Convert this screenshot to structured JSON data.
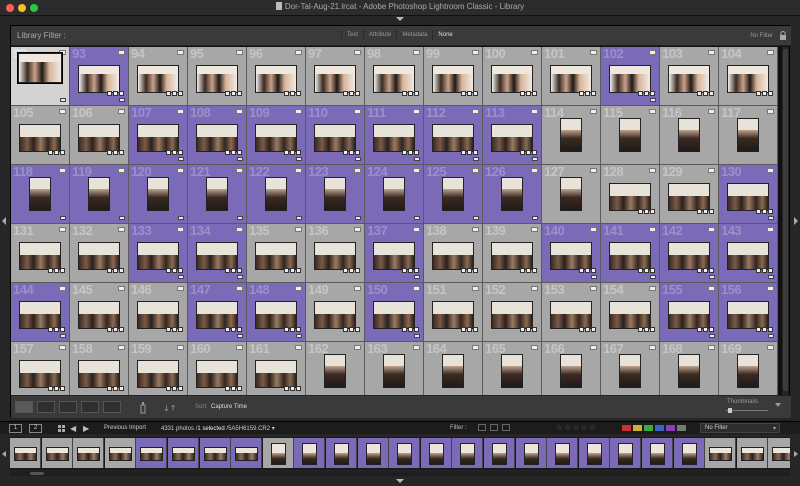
{
  "window": {
    "title": "Dor-Tal-Aug-21.lrcat - Adobe Photoshop Lightroom Classic - Library",
    "traffic_lights": [
      "#ff5f57",
      "#febc2e",
      "#28c840"
    ]
  },
  "filter_bar": {
    "label": "Library Filter :",
    "tabs": [
      "Text",
      "Attribute",
      "Metadata",
      "None"
    ],
    "active_tab": "None",
    "preset": "No Filter"
  },
  "grid": {
    "rows": [
      {
        "start": 92,
        "colors": [
          "selected",
          "purple",
          "gray",
          "gray",
          "gray",
          "gray",
          "gray",
          "gray",
          "gray",
          "gray",
          "purple",
          "gray",
          "gray"
        ],
        "kind": "early"
      },
      {
        "start": 105,
        "colors": [
          "gray",
          "gray",
          "purple",
          "purple",
          "purple",
          "purple",
          "purple",
          "purple",
          "purple",
          "gray",
          "gray",
          "gray",
          "gray"
        ],
        "kind": "mixed1"
      },
      {
        "start": 118,
        "colors": [
          "purple",
          "purple",
          "purple",
          "purple",
          "purple",
          "purple",
          "purple",
          "purple",
          "purple",
          "gray",
          "gray",
          "gray",
          "purple"
        ],
        "kind": "mixed2"
      },
      {
        "start": 131,
        "colors": [
          "gray",
          "gray",
          "purple",
          "purple",
          "gray",
          "gray",
          "purple",
          "gray",
          "gray",
          "purple",
          "purple",
          "purple",
          "purple"
        ],
        "kind": "land"
      },
      {
        "start": 144,
        "colors": [
          "purple",
          "gray",
          "gray",
          "purple",
          "purple",
          "gray",
          "purple",
          "gray",
          "gray",
          "gray",
          "gray",
          "purple",
          "purple"
        ],
        "kind": "land"
      },
      {
        "start": 157,
        "colors": [
          "gray",
          "gray",
          "gray",
          "gray",
          "gray",
          "gray",
          "gray",
          "gray",
          "gray",
          "gray",
          "gray",
          "gray",
          "gray"
        ],
        "kind": "mixed3"
      }
    ]
  },
  "toolbar": {
    "sort_label": "Sort:",
    "sort_value": "Capture Time",
    "thumbnails_label": "Thumbnails",
    "thumbnail_size": 0.05
  },
  "filmstrip_header": {
    "screen1": "1",
    "screen2": "2",
    "source": "Previous Import",
    "photo_count": "4331 photos /",
    "selected": "1 selected",
    "filename": "/5A5H6159.CR2",
    "filter_label": "Filter :",
    "preset": "No Filter",
    "stars": "☆☆☆☆☆",
    "colors": [
      "#c83232",
      "#c8b432",
      "#3caa3c",
      "#3c64c8",
      "#8c3cb4",
      "#777777"
    ]
  },
  "filmstrip": {
    "frames": [
      "gray",
      "gray",
      "gray",
      "gray",
      "purple",
      "purple",
      "purple",
      "purple",
      "gray",
      "purple",
      "purple",
      "purple",
      "purple",
      "purple",
      "purple",
      "purple",
      "purple",
      "purple",
      "purple",
      "purple",
      "purple",
      "purple",
      "gray",
      "gray",
      "gray"
    ],
    "orientation": [
      "l",
      "l",
      "l",
      "l",
      "l",
      "l",
      "l",
      "l",
      "p",
      "p",
      "p",
      "p",
      "p",
      "p",
      "p",
      "p",
      "p",
      "p",
      "p",
      "p",
      "p",
      "p",
      "l",
      "l",
      "l"
    ]
  },
  "icons": [
    "document-icon",
    "lock-icon",
    "grid-view-icon",
    "loupe-view-icon",
    "compare-view-icon",
    "survey-view-icon",
    "people-view-icon",
    "spray-can-icon",
    "sort-direction-icon",
    "grid-small-icon",
    "back-arrow-icon",
    "forward-arrow-icon",
    "flag-filter-icon",
    "dropdown-icon"
  ]
}
